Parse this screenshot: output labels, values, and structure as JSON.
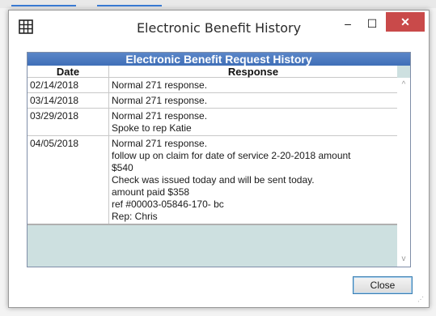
{
  "window": {
    "title": "Electronic Benefit History",
    "minimize_glyph": "–",
    "maximize_glyph": "☐",
    "close_glyph": "✕",
    "icon": "grid-icon"
  },
  "grid": {
    "header": "Electronic Benefit Request History",
    "columns": [
      "Date",
      "Response"
    ],
    "rows": [
      {
        "date": "02/14/2018",
        "response": [
          "Normal 271 response."
        ]
      },
      {
        "date": "03/14/2018",
        "response": [
          "Normal 271 response."
        ]
      },
      {
        "date": "03/29/2018",
        "response": [
          "Normal 271 response.",
          "Spoke  to rep Katie"
        ]
      },
      {
        "date": "04/05/2018",
        "response": [
          "Normal 271 response.",
          "follow up on claim for date of service 2-20-2018 amount",
          "$540",
          "Check was issued today and will be sent today.",
          "amount paid $358",
          "ref #00003-05846-170- bc",
          "Rep: Chris"
        ]
      }
    ],
    "scroll_up_glyph": "^",
    "scroll_down_glyph": "v"
  },
  "buttons": {
    "close": "Close"
  },
  "colors": {
    "header_blue": "#4a78c0",
    "empty_area": "#cde0e0",
    "close_red": "#c94a4a"
  }
}
